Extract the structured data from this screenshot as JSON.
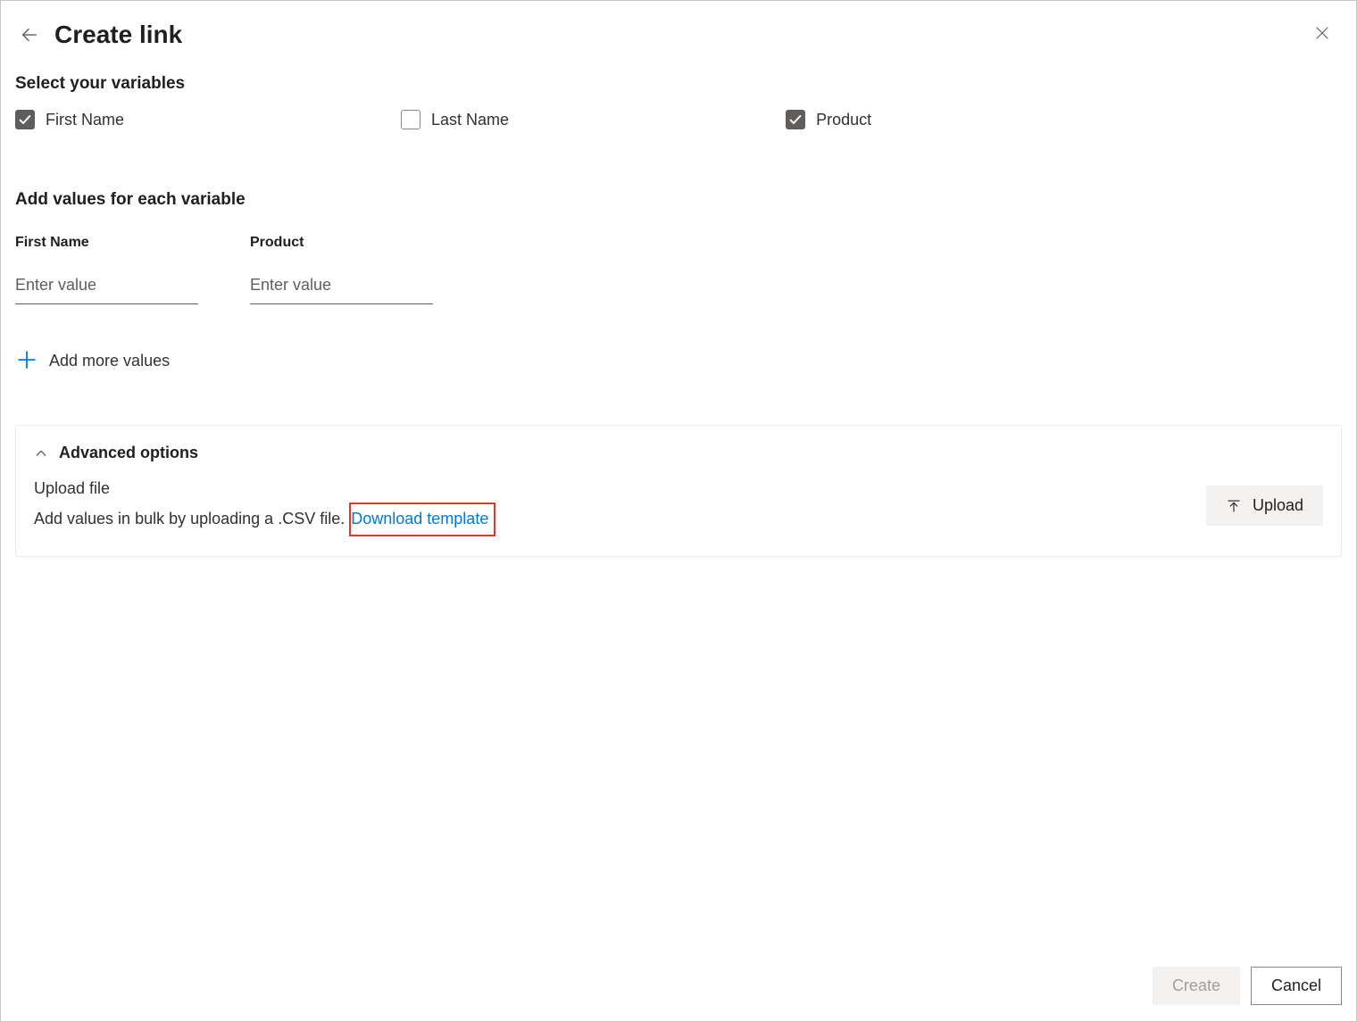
{
  "header": {
    "title": "Create link"
  },
  "variables": {
    "heading": "Select your variables",
    "items": [
      {
        "label": "First Name",
        "checked": true
      },
      {
        "label": "Last Name",
        "checked": false
      },
      {
        "label": "Product",
        "checked": true
      }
    ]
  },
  "values": {
    "heading": "Add values for each variable",
    "columns": [
      {
        "label": "First Name",
        "placeholder": "Enter value"
      },
      {
        "label": "Product",
        "placeholder": "Enter value"
      }
    ],
    "add_more_label": "Add more values"
  },
  "advanced": {
    "title": "Advanced options",
    "upload_heading": "Upload file",
    "upload_description": "Add values in bulk by uploading a .CSV file.",
    "download_link_label": "Download template",
    "upload_button_label": "Upload"
  },
  "footer": {
    "create_label": "Create",
    "cancel_label": "Cancel"
  }
}
